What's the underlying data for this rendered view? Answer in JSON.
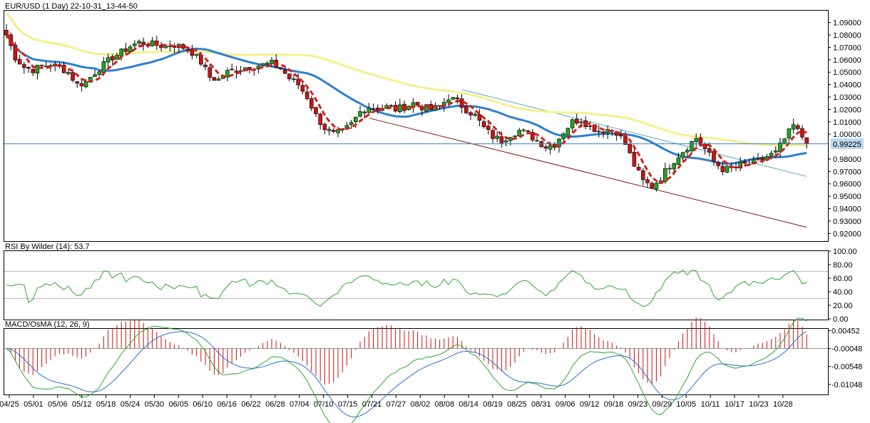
{
  "chart_data": [
    {
      "type": "candlestick",
      "title": "EUR/USD (1 Day) 22-10-31_13-44-50",
      "last_price_label": "0.99225",
      "last_price": 0.99225,
      "ylim": [
        0.915,
        1.099
      ],
      "y_ticks": [
        {
          "v": 1.09,
          "label": "1.09000"
        },
        {
          "v": 1.08,
          "label": "1.08000"
        },
        {
          "v": 1.07,
          "label": "1.07000"
        },
        {
          "v": 1.06,
          "label": "1.06000"
        },
        {
          "v": 1.05,
          "label": "1.05000"
        },
        {
          "v": 1.04,
          "label": "1.04000"
        },
        {
          "v": 1.03,
          "label": "1.03000"
        },
        {
          "v": 1.02,
          "label": "1.02000"
        },
        {
          "v": 1.01,
          "label": "1.01000"
        },
        {
          "v": 1.0,
          "label": "1.00000"
        },
        {
          "v": 0.98,
          "label": "0.98000"
        },
        {
          "v": 0.97,
          "label": "0.97000"
        },
        {
          "v": 0.96,
          "label": "0.96000"
        },
        {
          "v": 0.95,
          "label": "0.95000"
        },
        {
          "v": 0.94,
          "label": "0.94000"
        },
        {
          "v": 0.93,
          "label": "0.93000"
        },
        {
          "v": 0.92,
          "label": "0.92000"
        }
      ],
      "x_ticks": [
        "04/25",
        "05/01",
        "05/06",
        "05/12",
        "05/18",
        "05/24",
        "05/30",
        "06/05",
        "06/10",
        "06/16",
        "06/22",
        "06/28",
        "07/04",
        "07/10",
        "07/15",
        "07/21",
        "07/27",
        "08/02",
        "08/08",
        "08/14",
        "08/19",
        "08/25",
        "08/31",
        "09/06",
        "09/12",
        "09/18",
        "09/23",
        "09/29",
        "10/05",
        "10/11",
        "10/17",
        "10/23",
        "10/28"
      ],
      "close_anchors": [
        [
          0,
          1.08
        ],
        [
          2,
          1.062
        ],
        [
          4,
          1.054
        ],
        [
          6,
          1.052
        ],
        [
          8,
          1.055
        ],
        [
          10,
          1.056
        ],
        [
          12,
          1.054
        ],
        [
          14,
          1.05
        ],
        [
          16,
          1.04
        ],
        [
          18,
          1.042
        ],
        [
          20,
          1.05
        ],
        [
          22,
          1.056
        ],
        [
          24,
          1.062
        ],
        [
          26,
          1.066
        ],
        [
          28,
          1.071
        ],
        [
          30,
          1.074
        ],
        [
          32,
          1.073
        ],
        [
          34,
          1.072
        ],
        [
          36,
          1.071
        ],
        [
          38,
          1.072
        ],
        [
          40,
          1.07
        ],
        [
          42,
          1.066
        ],
        [
          44,
          1.058
        ],
        [
          46,
          1.046
        ],
        [
          48,
          1.044
        ],
        [
          50,
          1.05
        ],
        [
          52,
          1.052
        ],
        [
          54,
          1.054
        ],
        [
          56,
          1.055
        ],
        [
          58,
          1.056
        ],
        [
          60,
          1.057
        ],
        [
          62,
          1.053
        ],
        [
          64,
          1.045
        ],
        [
          66,
          1.04
        ],
        [
          68,
          1.03
        ],
        [
          70,
          1.015
        ],
        [
          72,
          1.005
        ],
        [
          74,
          1.0
        ],
        [
          76,
          1.002
        ],
        [
          78,
          1.008
        ],
        [
          80,
          1.018
        ],
        [
          82,
          1.022
        ],
        [
          84,
          1.021
        ],
        [
          86,
          1.022
        ],
        [
          88,
          1.02
        ],
        [
          90,
          1.022
        ],
        [
          92,
          1.025
        ],
        [
          94,
          1.022
        ],
        [
          96,
          1.02
        ],
        [
          98,
          1.022
        ],
        [
          100,
          1.03
        ],
        [
          102,
          1.026
        ],
        [
          104,
          1.02
        ],
        [
          106,
          1.015
        ],
        [
          108,
          1.005
        ],
        [
          110,
          0.998
        ],
        [
          112,
          0.995
        ],
        [
          114,
          1.0
        ],
        [
          116,
          1.003
        ],
        [
          118,
          1.0
        ],
        [
          120,
          0.995
        ],
        [
          122,
          0.99
        ],
        [
          124,
          0.992
        ],
        [
          126,
          1.002
        ],
        [
          128,
          1.01
        ],
        [
          130,
          1.012
        ],
        [
          132,
          1.006
        ],
        [
          134,
          1.003
        ],
        [
          136,
          1.004
        ],
        [
          138,
          1.002
        ],
        [
          140,
          0.992
        ],
        [
          142,
          0.975
        ],
        [
          144,
          0.962
        ],
        [
          146,
          0.958
        ],
        [
          148,
          0.965
        ],
        [
          150,
          0.975
        ],
        [
          152,
          0.983
        ],
        [
          154,
          0.99
        ],
        [
          156,
          0.997
        ],
        [
          158,
          0.988
        ],
        [
          160,
          0.978
        ],
        [
          162,
          0.972
        ],
        [
          164,
          0.972
        ],
        [
          166,
          0.975
        ],
        [
          168,
          0.976
        ],
        [
          170,
          0.978
        ],
        [
          172,
          0.982
        ],
        [
          174,
          0.985
        ],
        [
          176,
          0.996
        ],
        [
          178,
          1.007
        ],
        [
          180,
          0.998
        ],
        [
          181,
          0.992
        ]
      ],
      "overlays": [
        {
          "color": "#d0201e",
          "style": "dashed",
          "width": 3,
          "period": 5
        },
        {
          "color": "#2f7fd0",
          "style": "solid",
          "width": 3,
          "period": 21
        },
        {
          "color": "#f5f08c",
          "style": "solid",
          "width": 3,
          "period": 50
        }
      ],
      "trendlines": [
        {
          "color": "#5aa5c8",
          "x1": 103,
          "y1": 1.036,
          "x2": 181,
          "y2": 0.966
        },
        {
          "color": "#7a1818",
          "x1": 82,
          "y1": 1.013,
          "x2": 181,
          "y2": 0.925
        }
      ]
    },
    {
      "type": "line",
      "title": "RSI By Wilder (14): 53.7",
      "ylim": [
        0,
        100
      ],
      "y_ticks": [
        {
          "v": 100,
          "label": "100.00"
        },
        {
          "v": 80,
          "label": "80.00"
        },
        {
          "v": 60,
          "label": "60.00"
        },
        {
          "v": 40,
          "label": "40.00"
        },
        {
          "v": 20,
          "label": "20.00"
        },
        {
          "v": 0,
          "label": "0.00"
        }
      ],
      "levels": [
        70,
        30
      ],
      "color": "#2ea82e"
    },
    {
      "type": "bar+line",
      "title": "MACD/OsMA (12, 26, 9)",
      "ylim": [
        -0.0131,
        0.005
      ],
      "y_ticks": [
        {
          "v": 0.00452,
          "label": "0.00452"
        },
        {
          "v": -0.00048,
          "label": "-0.00048"
        },
        {
          "v": -0.00548,
          "label": "-0.00548"
        },
        {
          "v": -0.01048,
          "label": "-0.01048"
        }
      ],
      "zero": -0.00048,
      "osma_color": "#cc1010",
      "macd_color": "#2ea82e",
      "signal_color": "#2f6fd0"
    }
  ]
}
